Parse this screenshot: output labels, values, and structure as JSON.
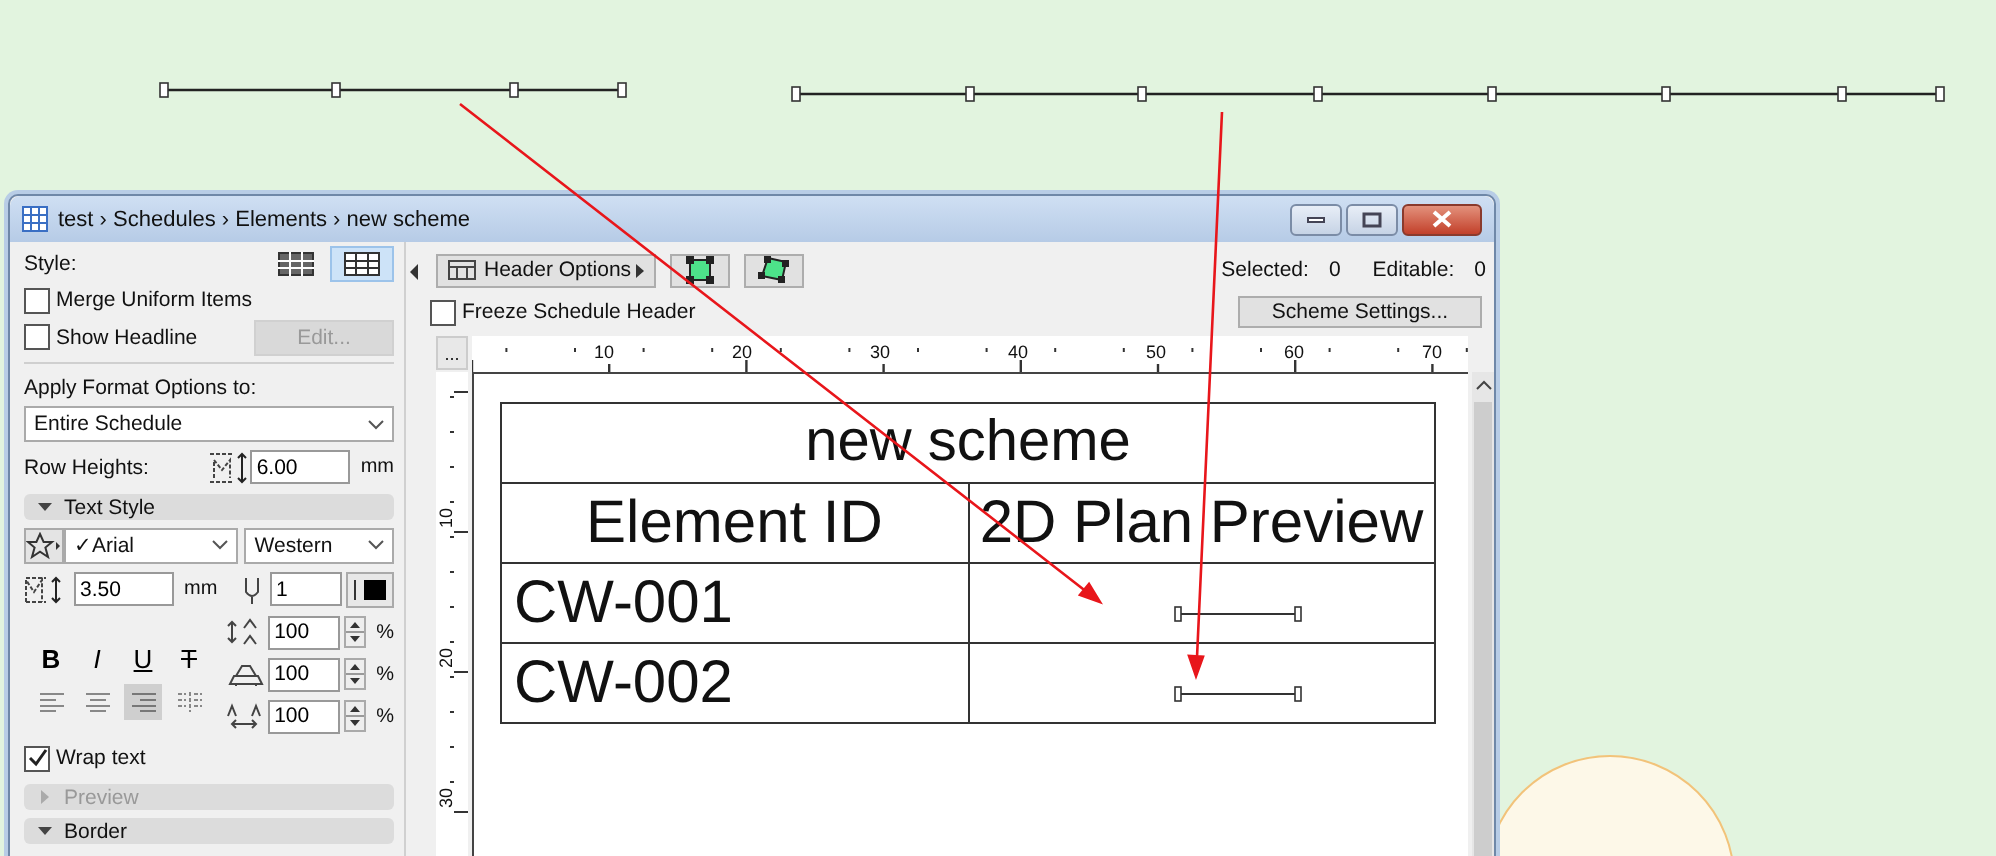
{
  "window": {
    "title": "test › Schedules › Elements › new scheme"
  },
  "left_panel": {
    "style_label": "Style:",
    "style_options": [
      {
        "selected": false
      },
      {
        "selected": true
      }
    ],
    "merge_uniform_items": {
      "label": "Merge Uniform Items",
      "checked": false
    },
    "show_headline": {
      "label": "Show Headline",
      "checked": false
    },
    "edit_button": {
      "label": "Edit...",
      "disabled": true
    },
    "apply_label": "Apply Format Options to:",
    "apply_dropdown": {
      "value": "Entire Schedule"
    },
    "row_heights": {
      "label": "Row Heights:",
      "value": "6.00",
      "unit": "mm"
    },
    "text_style_section": {
      "label": "Text Style",
      "expanded": true
    },
    "font_dropdown": {
      "value": "✓Arial"
    },
    "script_dropdown": {
      "value": "Western"
    },
    "font_size": {
      "value": "3.50",
      "unit": "mm"
    },
    "pen": {
      "value": "1"
    },
    "format_buttons": [
      {
        "label": "B",
        "kind": "bold"
      },
      {
        "label": "I",
        "kind": "italic"
      },
      {
        "label": "U",
        "kind": "underline"
      },
      {
        "label": "T",
        "kind": "strike"
      }
    ],
    "alignments": [
      {
        "selected": false
      },
      {
        "selected": false
      },
      {
        "selected": true
      },
      {
        "selected": false
      }
    ],
    "spacing_fields": [
      {
        "kind": "line",
        "value": "100",
        "unit": "%"
      },
      {
        "kind": "width",
        "value": "100",
        "unit": "%"
      },
      {
        "kind": "char",
        "value": "100",
        "unit": "%"
      }
    ],
    "wrap_text": {
      "label": "Wrap text",
      "checked": true
    },
    "preview_section": {
      "label": "Preview",
      "expanded": false,
      "disabled": true
    },
    "border_section": {
      "label": "Border",
      "expanded": true
    }
  },
  "toolbar": {
    "header_options_button": "Header Options",
    "selected_label": "Selected:",
    "selected_count": "0",
    "editable_label": "Editable:",
    "editable_count": "0"
  },
  "freeze_header": {
    "label": "Freeze Schedule Header",
    "checked": false
  },
  "scheme_settings_button": "Scheme Settings...",
  "ruler": {
    "button": "...",
    "ticks": [
      "10",
      "20",
      "30",
      "40",
      "50",
      "60",
      "70"
    ],
    "vertical_ticks": [
      "10",
      "20",
      "30"
    ]
  },
  "table": {
    "title": "new scheme",
    "columns": [
      "Element ID",
      "2D Plan Preview"
    ],
    "rows": [
      {
        "element_id": "CW-001"
      },
      {
        "element_id": "CW-002"
      }
    ]
  }
}
